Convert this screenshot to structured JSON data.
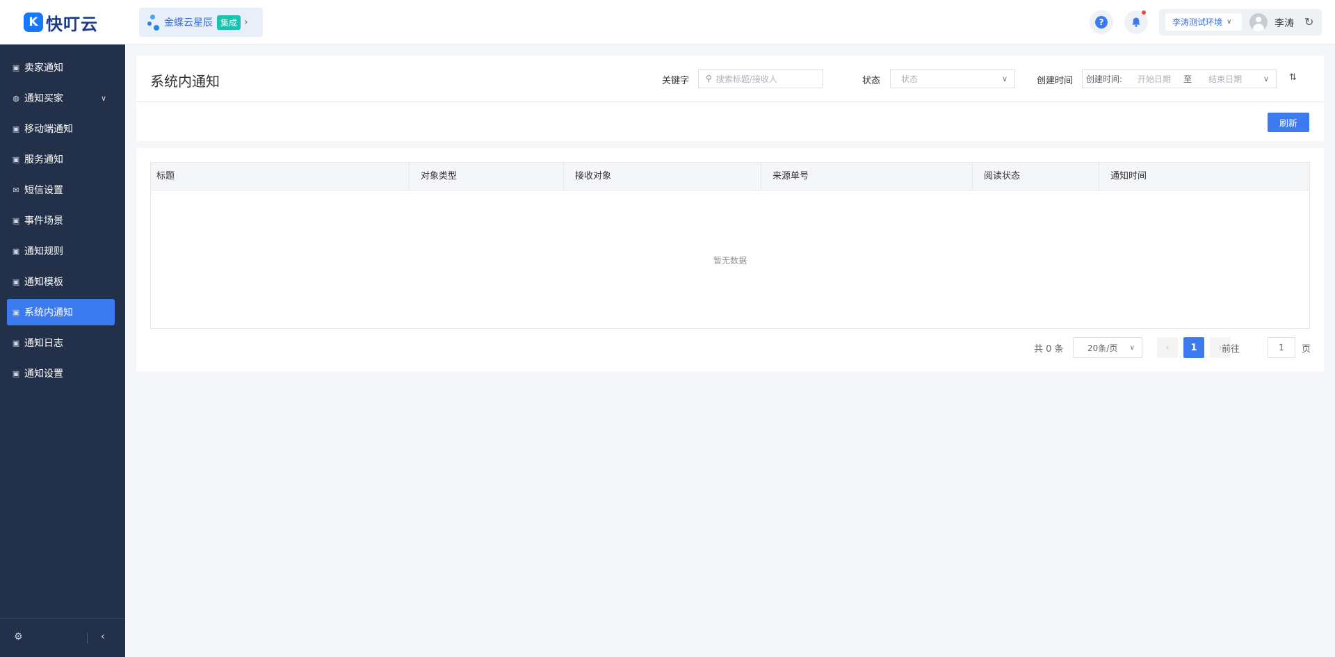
{
  "app": {
    "logo_glyph": "K",
    "logo_text": "快叮云",
    "brand_color": "#3c7af0"
  },
  "header": {
    "integration_name": "金蝶云星辰",
    "integration_badge": "集成",
    "environment": "李涛测试环境",
    "username": "李涛",
    "help_glyph": "?"
  },
  "sidebar": {
    "items": [
      {
        "label": "卖家通知",
        "icon": "notice-icon"
      },
      {
        "label": "通知买家",
        "icon": "chat-icon",
        "has_submenu": true
      },
      {
        "label": "移动端通知",
        "icon": "notice-icon"
      },
      {
        "label": "服务通知",
        "icon": "notice-icon"
      },
      {
        "label": "短信设置",
        "icon": "mail-icon"
      },
      {
        "label": "事件场景",
        "icon": "notice-icon"
      },
      {
        "label": "通知规则",
        "icon": "notice-icon"
      },
      {
        "label": "通知模板",
        "icon": "notice-icon"
      },
      {
        "label": "系统内通知",
        "icon": "notice-icon",
        "active": true
      },
      {
        "label": "通知日志",
        "icon": "notice-icon"
      },
      {
        "label": "通知设置",
        "icon": "notice-icon"
      }
    ]
  },
  "filters": {
    "page_title": "系统内通知",
    "keyword_label": "关键字",
    "keyword_placeholder": "搜索标题/接收人",
    "status_label": "状态",
    "status_placeholder": "状态",
    "created_label": "创建时间",
    "created_prefix": "创建时间:",
    "start_placeholder": "开始日期",
    "range_sep": "至",
    "end_placeholder": "结束日期",
    "refresh_label": "刷新"
  },
  "table": {
    "columns": [
      "标题",
      "对象类型",
      "接收对象",
      "来源单号",
      "阅读状态",
      "通知时间"
    ],
    "rows": [],
    "empty_text": "暂无数据"
  },
  "pagination": {
    "total_text": "共 0 条",
    "page_size": "20条/页",
    "current_page": "1",
    "goto_label": "前往",
    "goto_value": "1",
    "page_unit": "页"
  }
}
